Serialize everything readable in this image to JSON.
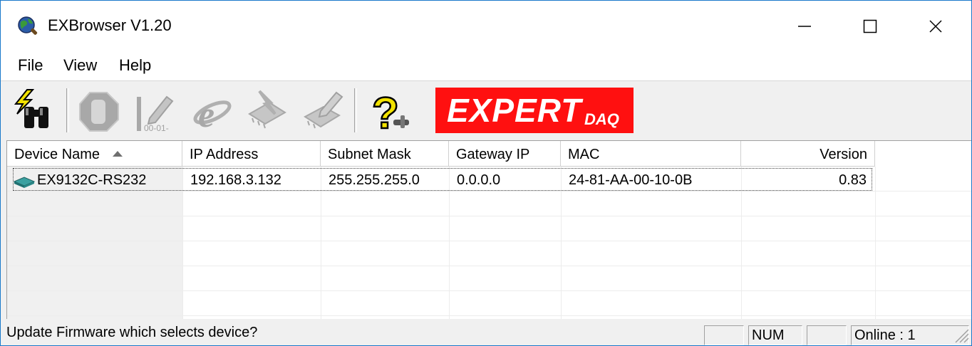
{
  "window": {
    "title": "EXBrowser V1.20",
    "controls": {
      "minimize": "minimize",
      "maximize": "maximize",
      "close": "close"
    }
  },
  "menu": [
    {
      "label": "File"
    },
    {
      "label": "View"
    },
    {
      "label": "Help"
    }
  ],
  "toolbar": {
    "buttons": [
      {
        "name": "search-devices",
        "icon": "binoculars-lightning-icon",
        "enabled": true
      },
      {
        "name": "stop",
        "icon": "stop-hand-icon",
        "enabled": false
      },
      {
        "name": "set-ip",
        "icon": "ip-config-icon",
        "enabled": false
      },
      {
        "name": "web-browser",
        "icon": "internet-explorer-icon",
        "enabled": false
      },
      {
        "name": "update-firmware",
        "icon": "chip-update-icon",
        "enabled": false
      },
      {
        "name": "config-chip",
        "icon": "chip-config-icon",
        "enabled": false
      },
      {
        "name": "help",
        "icon": "help-question-icon",
        "enabled": true
      }
    ],
    "logo": {
      "main": "EXPERT",
      "sub": "DAQ",
      "color": "#ff1010"
    }
  },
  "list": {
    "columns": [
      {
        "label": "Device Name",
        "sorted": "ascending"
      },
      {
        "label": "IP Address"
      },
      {
        "label": "Subnet Mask"
      },
      {
        "label": "Gateway IP"
      },
      {
        "label": "MAC"
      },
      {
        "label": "Version"
      }
    ],
    "rows": [
      {
        "device_name": "EX9132C-RS232",
        "ip_address": "192.168.3.132",
        "subnet_mask": "255.255.255.0",
        "gateway_ip": "0.0.0.0",
        "mac": "24-81-AA-00-10-0B",
        "version": "0.83"
      }
    ]
  },
  "status": {
    "message": "Update Firmware which selects device?",
    "panes": [
      "",
      "NUM",
      "",
      "Online : 1"
    ]
  },
  "colors": {
    "accent_border": "#1979ca",
    "logo_red": "#ff1010"
  }
}
